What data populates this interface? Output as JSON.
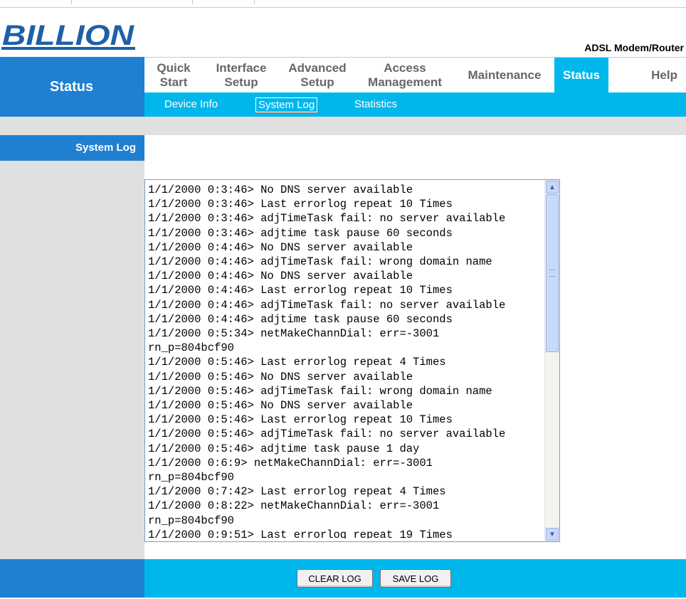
{
  "brand": {
    "logo_text": "BILLION",
    "model": "ADSL Modem/Router"
  },
  "section_title": "Status",
  "nav": [
    {
      "label": "Quick\nStart",
      "active": false
    },
    {
      "label": "Interface\nSetup",
      "active": false
    },
    {
      "label": "Advanced\nSetup",
      "active": false
    },
    {
      "label": "Access\nManagement",
      "active": false
    },
    {
      "label": "Maintenance",
      "active": false
    },
    {
      "label": "Status",
      "active": true
    },
    {
      "label": "Help",
      "active": false
    }
  ],
  "subnav": [
    {
      "label": "Device Info",
      "active": false
    },
    {
      "label": "System Log",
      "active": true
    },
    {
      "label": "Statistics",
      "active": false
    }
  ],
  "sidebar": {
    "label": "System Log"
  },
  "log": {
    "lines": [
      "1/1/2000 0:3:46> No DNS server available",
      "1/1/2000 0:3:46> Last errorlog repeat 10 Times",
      "1/1/2000 0:3:46> adjTimeTask fail: no server available",
      "1/1/2000 0:3:46> adjtime task pause 60 seconds",
      "1/1/2000 0:4:46> No DNS server available",
      "1/1/2000 0:4:46> adjTimeTask fail: wrong domain name",
      "1/1/2000 0:4:46> No DNS server available",
      "1/1/2000 0:4:46> Last errorlog repeat 10 Times",
      "1/1/2000 0:4:46> adjTimeTask fail: no server available",
      "1/1/2000 0:4:46> adjtime task pause 60 seconds",
      "1/1/2000 0:5:34> netMakeChannDial: err=-3001",
      "rn_p=804bcf90",
      "1/1/2000 0:5:46> Last errorlog repeat 4 Times",
      "1/1/2000 0:5:46> No DNS server available",
      "1/1/2000 0:5:46> adjTimeTask fail: wrong domain name",
      "1/1/2000 0:5:46> No DNS server available",
      "1/1/2000 0:5:46> Last errorlog repeat 10 Times",
      "1/1/2000 0:5:46> adjTimeTask fail: no server available",
      "1/1/2000 0:5:46> adjtime task pause 1 day",
      "1/1/2000 0:6:9> netMakeChannDial: err=-3001",
      "rn_p=804bcf90",
      "1/1/2000 0:7:42> Last errorlog repeat 4 Times",
      "1/1/2000 0:8:22> netMakeChannDial: err=-3001",
      "rn_p=804bcf90",
      "1/1/2000 0:9:51> Last errorlog repeat 19 Times"
    ]
  },
  "buttons": {
    "clear": "CLEAR LOG",
    "save": "SAVE LOG"
  },
  "colors": {
    "dark_blue": "#1f80d2",
    "cyan": "#00b7eb",
    "gray": "#e0e0e0"
  },
  "icons": {
    "scroll_up": "scroll-up-arrow-icon",
    "scroll_down": "scroll-down-arrow-icon"
  }
}
